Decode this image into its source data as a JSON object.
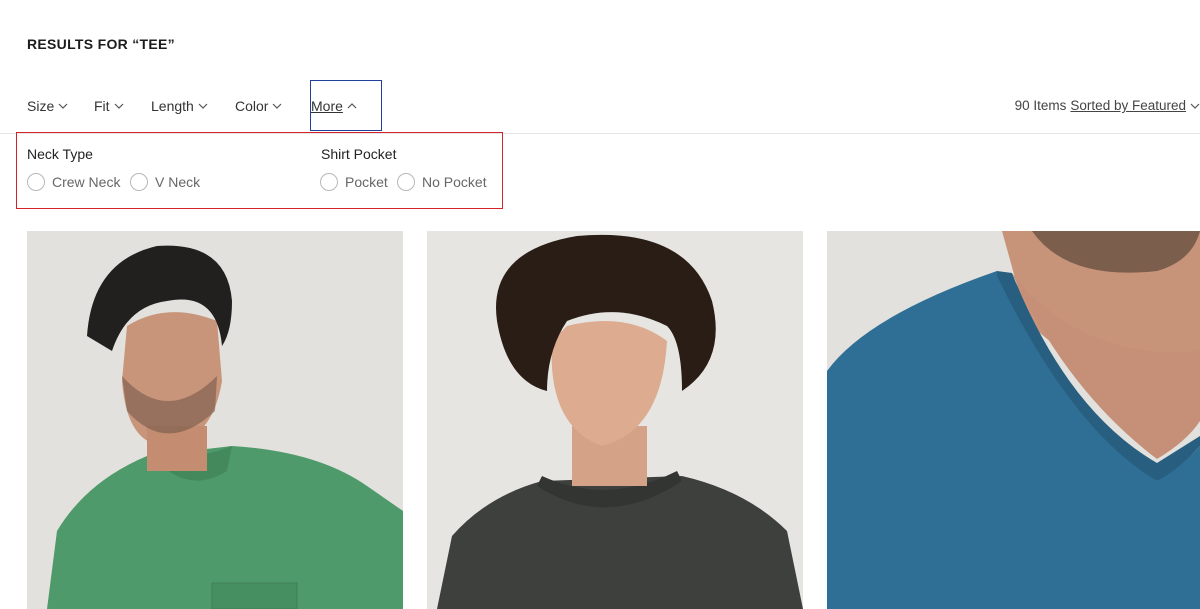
{
  "header": {
    "title": "RESULTS FOR “TEE”"
  },
  "filters": {
    "size": "Size",
    "fit": "Fit",
    "length": "Length",
    "color": "Color",
    "more": "More"
  },
  "sort": {
    "count": "90 Items",
    "label": "Sorted by Featured"
  },
  "panel": {
    "neck_type": {
      "title": "Neck Type",
      "options": [
        "Crew Neck",
        "V Neck"
      ]
    },
    "shirt_pocket": {
      "title": "Shirt Pocket",
      "options": [
        "Pocket",
        "No Pocket"
      ]
    }
  },
  "colors": {
    "highlight_red": "#d3232b",
    "active_blue": "#1f3f9a",
    "shirt_green": "#4f9a6a",
    "shirt_charcoal": "#3e403d",
    "shirt_blue": "#2f6f95"
  }
}
